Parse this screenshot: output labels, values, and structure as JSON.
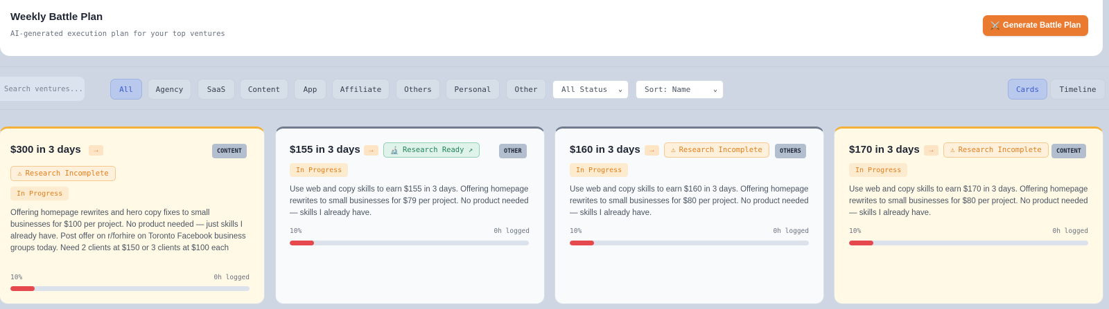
{
  "header": {
    "title": "Weekly Battle Plan",
    "subtitle": "AI-generated execution plan for your top ventures",
    "generate_icon": "⚔️",
    "generate_label": "Generate Battle Plan"
  },
  "filters": {
    "search_placeholder": "Search ventures...",
    "categories": [
      "All",
      "Agency",
      "SaaS",
      "Content",
      "App",
      "Affiliate",
      "Others",
      "Personal",
      "Other"
    ],
    "active_category": "All",
    "status_select": "All Status",
    "sort_select": "Sort: Name",
    "view_toggle": [
      "Cards",
      "Timeline"
    ],
    "active_view": "Cards"
  },
  "colors": {
    "accent_orange": "#ea7a30",
    "progress_red": "#e5484d",
    "card_yellow_bg": "#fff9e5",
    "card_white_bg": "#f8fafc"
  },
  "cards": [
    {
      "title": "$300 in 3 days",
      "arrow": "→",
      "category": "CONTENT",
      "research_icon": "⚠",
      "research": "Research Incomplete",
      "status": "In Progress",
      "description": "Offering homepage rewrites and hero copy fixes to small businesses for $100 per project. No product needed — just skills I already have. Post offer on r/forhire on Toronto Facebook business groups today. Need 2 clients at $150 or 3 clients at $100 each",
      "progress_label": "10%",
      "progress": 0.1,
      "logged": "0h logged"
    },
    {
      "title": "$155 in 3 days",
      "arrow": "→",
      "category": "OTHER",
      "research_icon": "🔬",
      "research": "Research Ready ↗",
      "status": "In Progress",
      "description": "Use web and copy skills to earn $155 in 3 days. Offering homepage rewrites to small businesses for $79 per project. No product needed — skills I already have.",
      "progress_label": "10%",
      "progress": 0.1,
      "logged": "0h logged"
    },
    {
      "title": "$160 in 3 days",
      "arrow": "→",
      "category": "OTHERS",
      "research_icon": "⚠",
      "research": "Research Incomplete",
      "status": "In Progress",
      "description": "Use web and copy skills to earn $160 in 3 days. Offering homepage rewrites to small businesses for $80 per project. No product needed — skills I already have.",
      "progress_label": "10%",
      "progress": 0.1,
      "logged": "0h logged"
    },
    {
      "title": "$170 in 3 days",
      "arrow": "→",
      "category": "CONTENT",
      "research_icon": "⚠",
      "research": "Research Incomplete",
      "status": "In Progress",
      "description": "Use web and copy skills to earn $170 in 3 days. Offering homepage rewrites to small businesses for $80 per project. No product needed — skills I already have.",
      "progress_label": "10%",
      "progress": 0.1,
      "logged": "0h logged"
    }
  ]
}
